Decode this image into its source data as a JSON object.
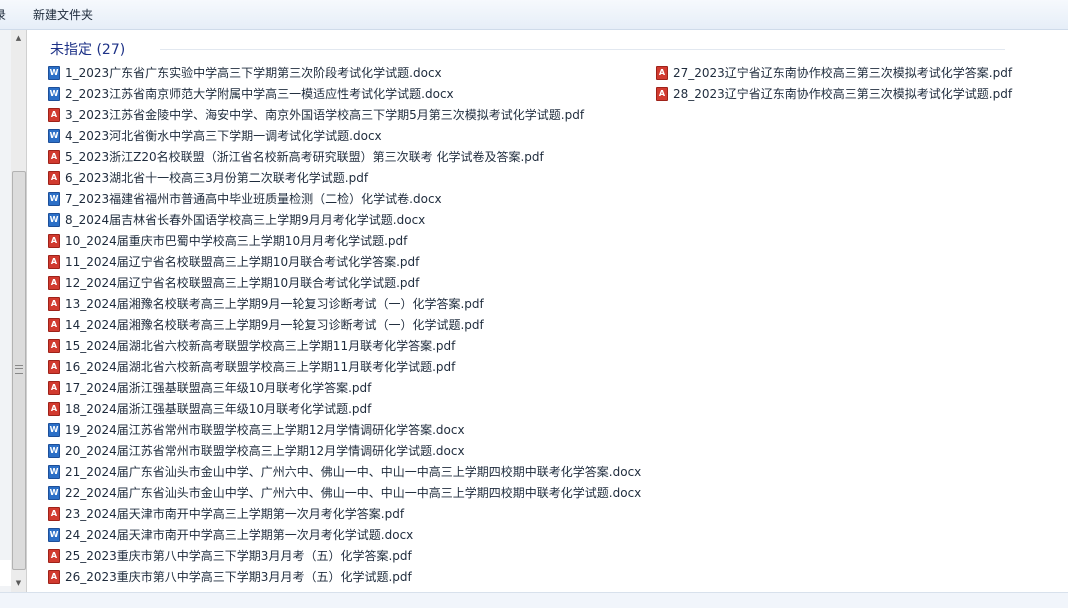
{
  "toolbar": {
    "cut_label": "录",
    "new_folder_label": "新建文件夹"
  },
  "group": {
    "title": "未指定 (27)"
  },
  "icons": {
    "docx": {
      "name": "word-document-icon",
      "glyph": "W",
      "color": "#2b6fc7"
    },
    "pdf": {
      "name": "pdf-document-icon",
      "glyph": "A",
      "color": "#d13a2f"
    }
  },
  "files_col1": [
    {
      "name": "1_2023广东省广东实验中学高三下学期第三次阶段考试化学试题.docx",
      "type": "docx"
    },
    {
      "name": "2_2023江苏省南京师范大学附属中学高三一模适应性考试化学试题.docx",
      "type": "docx"
    },
    {
      "name": "3_2023江苏省金陵中学、海安中学、南京外国语学校高三下学期5月第三次模拟考试化学试题.pdf",
      "type": "pdf"
    },
    {
      "name": "4_2023河北省衡水中学高三下学期一调考试化学试题.docx",
      "type": "docx"
    },
    {
      "name": "5_2023浙江Z20名校联盟（浙江省名校新高考研究联盟）第三次联考 化学试卷及答案.pdf",
      "type": "pdf"
    },
    {
      "name": "6_2023湖北省十一校高三3月份第二次联考化学试题.pdf",
      "type": "pdf"
    },
    {
      "name": "7_2023福建省福州市普通高中毕业班质量检测（二检）化学试卷.docx",
      "type": "docx"
    },
    {
      "name": "8_2024届吉林省长春外国语学校高三上学期9月月考化学试题.docx",
      "type": "docx"
    },
    {
      "name": "10_2024届重庆市巴蜀中学校高三上学期10月月考化学试题.pdf",
      "type": "pdf"
    },
    {
      "name": "11_2024届辽宁省名校联盟高三上学期10月联合考试化学答案.pdf",
      "type": "pdf"
    },
    {
      "name": "12_2024届辽宁省名校联盟高三上学期10月联合考试化学试题.pdf",
      "type": "pdf"
    },
    {
      "name": "13_2024届湘豫名校联考高三上学期9月一轮复习诊断考试（一）化学答案.pdf",
      "type": "pdf"
    },
    {
      "name": "14_2024届湘豫名校联考高三上学期9月一轮复习诊断考试（一）化学试题.pdf",
      "type": "pdf"
    },
    {
      "name": "15_2024届湖北省六校新高考联盟学校高三上学期11月联考化学答案.pdf",
      "type": "pdf"
    },
    {
      "name": "16_2024届湖北省六校新高考联盟学校高三上学期11月联考化学试题.pdf",
      "type": "pdf"
    },
    {
      "name": "17_2024届浙江强基联盟高三年级10月联考化学答案.pdf",
      "type": "pdf"
    },
    {
      "name": "18_2024届浙江强基联盟高三年级10月联考化学试题.pdf",
      "type": "pdf"
    },
    {
      "name": "19_2024届江苏省常州市联盟学校高三上学期12月学情调研化学答案.docx",
      "type": "docx"
    },
    {
      "name": "20_2024届江苏省常州市联盟学校高三上学期12月学情调研化学试题.docx",
      "type": "docx"
    },
    {
      "name": "21_2024届广东省汕头市金山中学、广州六中、佛山一中、中山一中高三上学期四校期中联考化学答案.docx",
      "type": "docx"
    },
    {
      "name": "22_2024届广东省汕头市金山中学、广州六中、佛山一中、中山一中高三上学期四校期中联考化学试题.docx",
      "type": "docx"
    },
    {
      "name": "23_2024届天津市南开中学高三上学期第一次月考化学答案.pdf",
      "type": "pdf"
    },
    {
      "name": "24_2024届天津市南开中学高三上学期第一次月考化学试题.docx",
      "type": "docx"
    },
    {
      "name": "25_2023重庆市第八中学高三下学期3月月考（五）化学答案.pdf",
      "type": "pdf"
    },
    {
      "name": "26_2023重庆市第八中学高三下学期3月月考（五）化学试题.pdf",
      "type": "pdf"
    }
  ],
  "files_col2": [
    {
      "name": "27_2023辽宁省辽东南协作校高三第三次模拟考试化学答案.pdf",
      "type": "pdf"
    },
    {
      "name": "28_2023辽宁省辽东南协作校高三第三次模拟考试化学试题.pdf",
      "type": "pdf"
    }
  ]
}
